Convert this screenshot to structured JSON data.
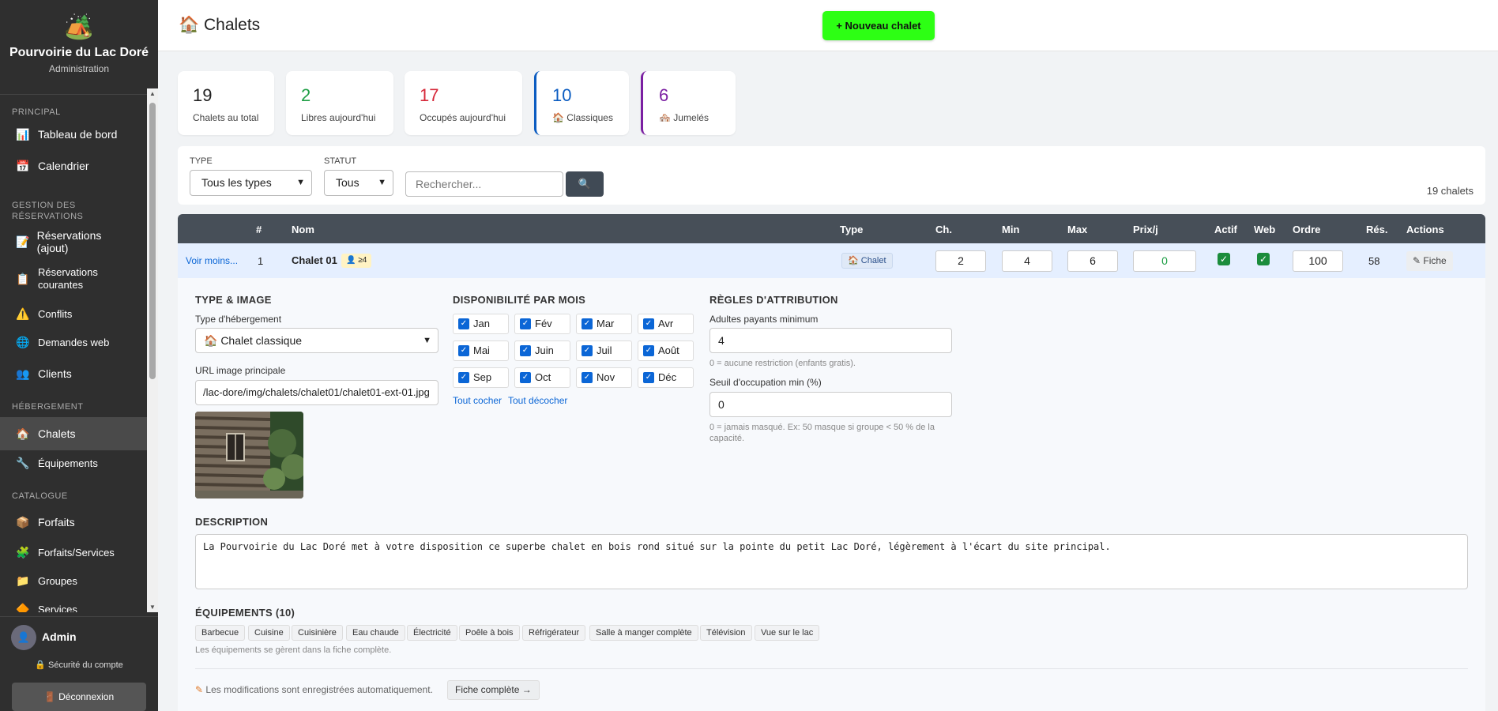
{
  "brand": {
    "logo": "🏕️",
    "name": "Pourvoirie du Lac Doré",
    "sub": "Administration"
  },
  "nav": {
    "sections": [
      "Principal",
      "Gestion des réservations",
      "Hébergement",
      "Catalogue"
    ],
    "items": [
      {
        "icon": "📊",
        "label": "Tableau de bord"
      },
      {
        "icon": "📅",
        "label": "Calendrier"
      },
      {
        "icon": "📝",
        "label": "Réservations (ajout)"
      },
      {
        "icon": "📋",
        "label": "Réservations courantes"
      },
      {
        "icon": "⚠️",
        "label": "Conflits"
      },
      {
        "icon": "🌐",
        "label": "Demandes web"
      },
      {
        "icon": "👥",
        "label": "Clients"
      },
      {
        "icon": "🏠",
        "label": "Chalets"
      },
      {
        "icon": "🔧",
        "label": "Équipements"
      },
      {
        "icon": "📦",
        "label": "Forfaits"
      },
      {
        "icon": "🧩",
        "label": "Forfaits/Services"
      },
      {
        "icon": "📁",
        "label": "Groupes"
      },
      {
        "icon": "🔶",
        "label": "Services"
      }
    ]
  },
  "user": {
    "avatar": "👤",
    "name": "Admin",
    "security": "🔒 Sécurité du compte",
    "logout": "🚪 Déconnexion"
  },
  "header": {
    "title": "🏠 Chalets",
    "new_button": "+ Nouveau chalet"
  },
  "stats": [
    {
      "value": "19",
      "label": "Chalets au total",
      "color": "#333333"
    },
    {
      "value": "2",
      "label": "Libres aujourd'hui",
      "color": "#1e9e45"
    },
    {
      "value": "17",
      "label": "Occupés aujourd'hui",
      "color": "#d62839"
    },
    {
      "value": "10",
      "label": "🏠 Classiques",
      "color": "#0b5cc1"
    },
    {
      "value": "6",
      "label": "🏘️ Jumelés",
      "color": "#7b1fa2"
    }
  ],
  "filters": {
    "type_label": "TYPE",
    "type_value": "Tous les types",
    "status_label": "STATUT",
    "status_value": "Tous",
    "search_placeholder": "Rechercher...",
    "search_icon": "🔍",
    "count": "19 chalets"
  },
  "table": {
    "headers": [
      "#",
      "Nom",
      "Type",
      "Ch.",
      "Min",
      "Max",
      "Prix/j",
      "Actif",
      "Web",
      "Ordre",
      "Rés.",
      "Actions"
    ],
    "row": {
      "toggle": "Voir moins...",
      "num": "1",
      "name": "Chalet 01",
      "badge": "👤 ≥4",
      "type": "🏠 Chalet",
      "ch": "2",
      "min": "4",
      "max": "6",
      "prix": "0",
      "actif": true,
      "web": true,
      "ordre": "100",
      "res": "58",
      "action": "✎ Fiche"
    }
  },
  "detail": {
    "type_section": "TYPE & IMAGE",
    "type_label": "Type d'hébergement",
    "type_value": "🏠 Chalet classique",
    "url_label": "URL image principale",
    "url_value": "/lac-dore/img/chalets/chalet01/chalet01-ext-01.jpg",
    "dispo_section": "DISPONIBILITÉ PAR MOIS",
    "months": [
      "Jan",
      "Fév",
      "Mar",
      "Avr",
      "Mai",
      "Juin",
      "Juil",
      "Août",
      "Sep",
      "Oct",
      "Nov",
      "Déc"
    ],
    "check_all": "Tout cocher",
    "uncheck_all": "Tout décocher",
    "rules_section": "RÈGLES D'ATTRIBUTION",
    "adults_label": "Adultes payants minimum",
    "adults_value": "4",
    "adults_hint": "0 = aucune restriction (enfants gratis).",
    "seuil_label": "Seuil d'occupation min (%)",
    "seuil_value": "0",
    "seuil_hint": "0 = jamais masqué. Ex: 50 masque si groupe < 50 % de la capacité.",
    "desc_section": "DESCRIPTION",
    "desc_value": "La Pourvoirie du Lac Doré met à votre disposition ce superbe chalet en bois rond situé sur la pointe du petit Lac Doré, légèrement à l'écart du site principal.",
    "equip_section": "ÉQUIPEMENTS (10)",
    "equipements": [
      "Barbecue",
      "Cuisine",
      "Cuisinière",
      "Eau chaude",
      "Électricité",
      "Poêle à bois",
      "Réfrigérateur",
      "Salle à manger complète",
      "Télévision",
      "Vue sur le lac"
    ],
    "equip_hint": "Les équipements se gèrent dans la fiche complète.",
    "autosave": "Les modifications sont enregistrées automatiquement.",
    "full_button": "Fiche complète →"
  }
}
